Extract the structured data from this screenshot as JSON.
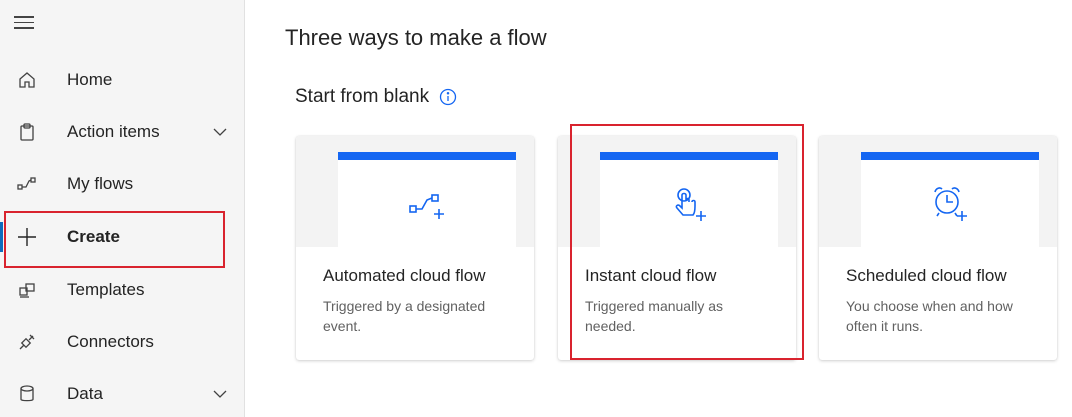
{
  "sidebar": {
    "items": [
      {
        "label": "Home",
        "icon": "home-icon"
      },
      {
        "label": "Action items",
        "icon": "clipboard-icon",
        "expandable": true
      },
      {
        "label": "My flows",
        "icon": "flow-icon"
      },
      {
        "label": "Create",
        "icon": "plus-icon",
        "active": true
      },
      {
        "label": "Templates",
        "icon": "templates-icon"
      },
      {
        "label": "Connectors",
        "icon": "connector-icon"
      },
      {
        "label": "Data",
        "icon": "database-icon",
        "expandable": true
      }
    ]
  },
  "main": {
    "title": "Three ways to make a flow",
    "section_title": "Start from blank",
    "cards": [
      {
        "title": "Automated cloud flow",
        "description": "Triggered by a designated event.",
        "icon": "automated-flow-icon"
      },
      {
        "title": "Instant cloud flow",
        "description": "Triggered manually as needed.",
        "icon": "touch-icon"
      },
      {
        "title": "Scheduled cloud flow",
        "description": "You choose when and how often it runs.",
        "icon": "alarm-clock-icon"
      }
    ]
  },
  "colors": {
    "accent": "#1466f2",
    "highlight": "#d9232e",
    "sidebar_bg": "#f5f5f5"
  }
}
